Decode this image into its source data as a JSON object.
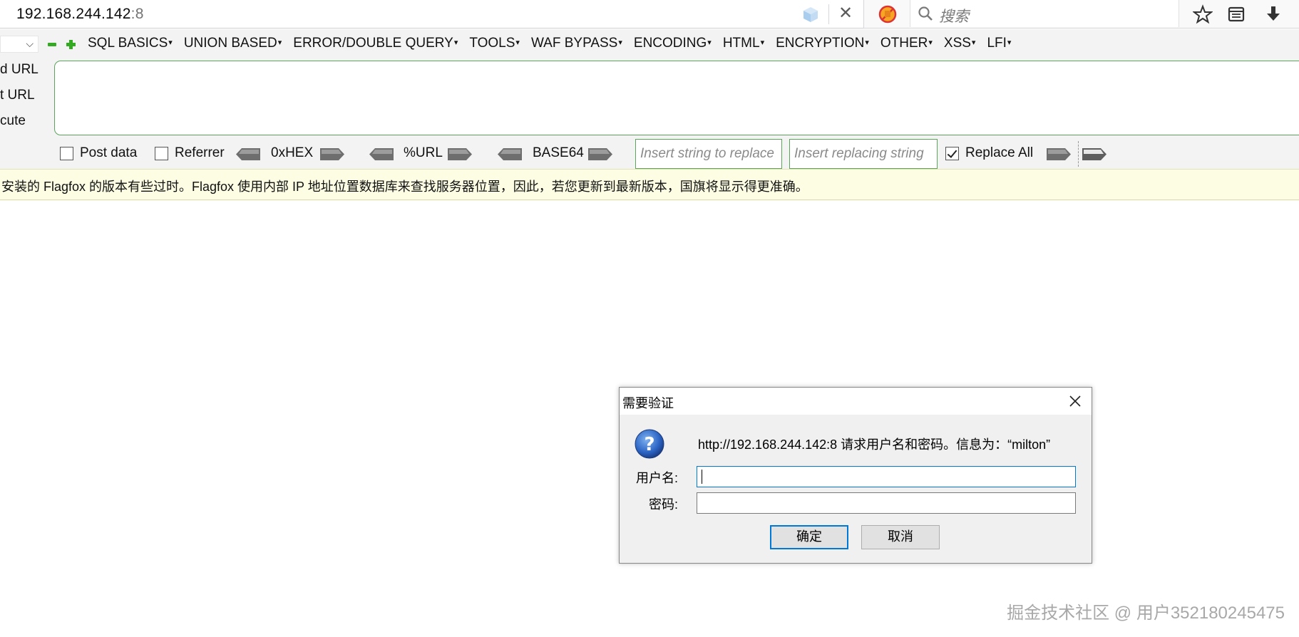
{
  "address_bar": {
    "url_host": "192.168.244.142",
    "url_port": ":8"
  },
  "search": {
    "placeholder": "搜索"
  },
  "hackbar": {
    "menu": [
      "SQL BASICS",
      "UNION BASED",
      "ERROR/DOUBLE QUERY",
      "TOOLS",
      "WAF BYPASS",
      "ENCODING",
      "HTML",
      "ENCRYPTION",
      "OTHER",
      "XSS",
      "LFI"
    ],
    "side_labels": {
      "load_url": "d URL",
      "split_url": "t URL",
      "execute": "cute"
    },
    "options": {
      "post_data": "Post data",
      "referrer": "Referrer",
      "hex": "0xHEX",
      "url": "%URL",
      "base64": "BASE64",
      "replace_placeholder": "Insert string to replace",
      "replacing_placeholder": "Insert replacing string",
      "replace_all": "Replace All"
    }
  },
  "notification": {
    "text": "安装的 Flagfox 的版本有些过时。Flagfox 使用内部 IP 地址位置数据库来查找服务器位置，因此，若您更新到最新版本，国旗将显示得更准确。"
  },
  "dialog": {
    "title": "需要验证",
    "message": "http://192.168.244.142:8 请求用户名和密码。信息为：“milton”",
    "username_label": "用户名:",
    "password_label": "密码:",
    "ok_label": "确定",
    "cancel_label": "取消"
  },
  "watermark": "掘金技术社区 @ 用户352180245475",
  "colors": {
    "accent_green": "#5ca35c",
    "dialog_focus": "#0078d7",
    "notify_bg": "#fdfde4"
  }
}
